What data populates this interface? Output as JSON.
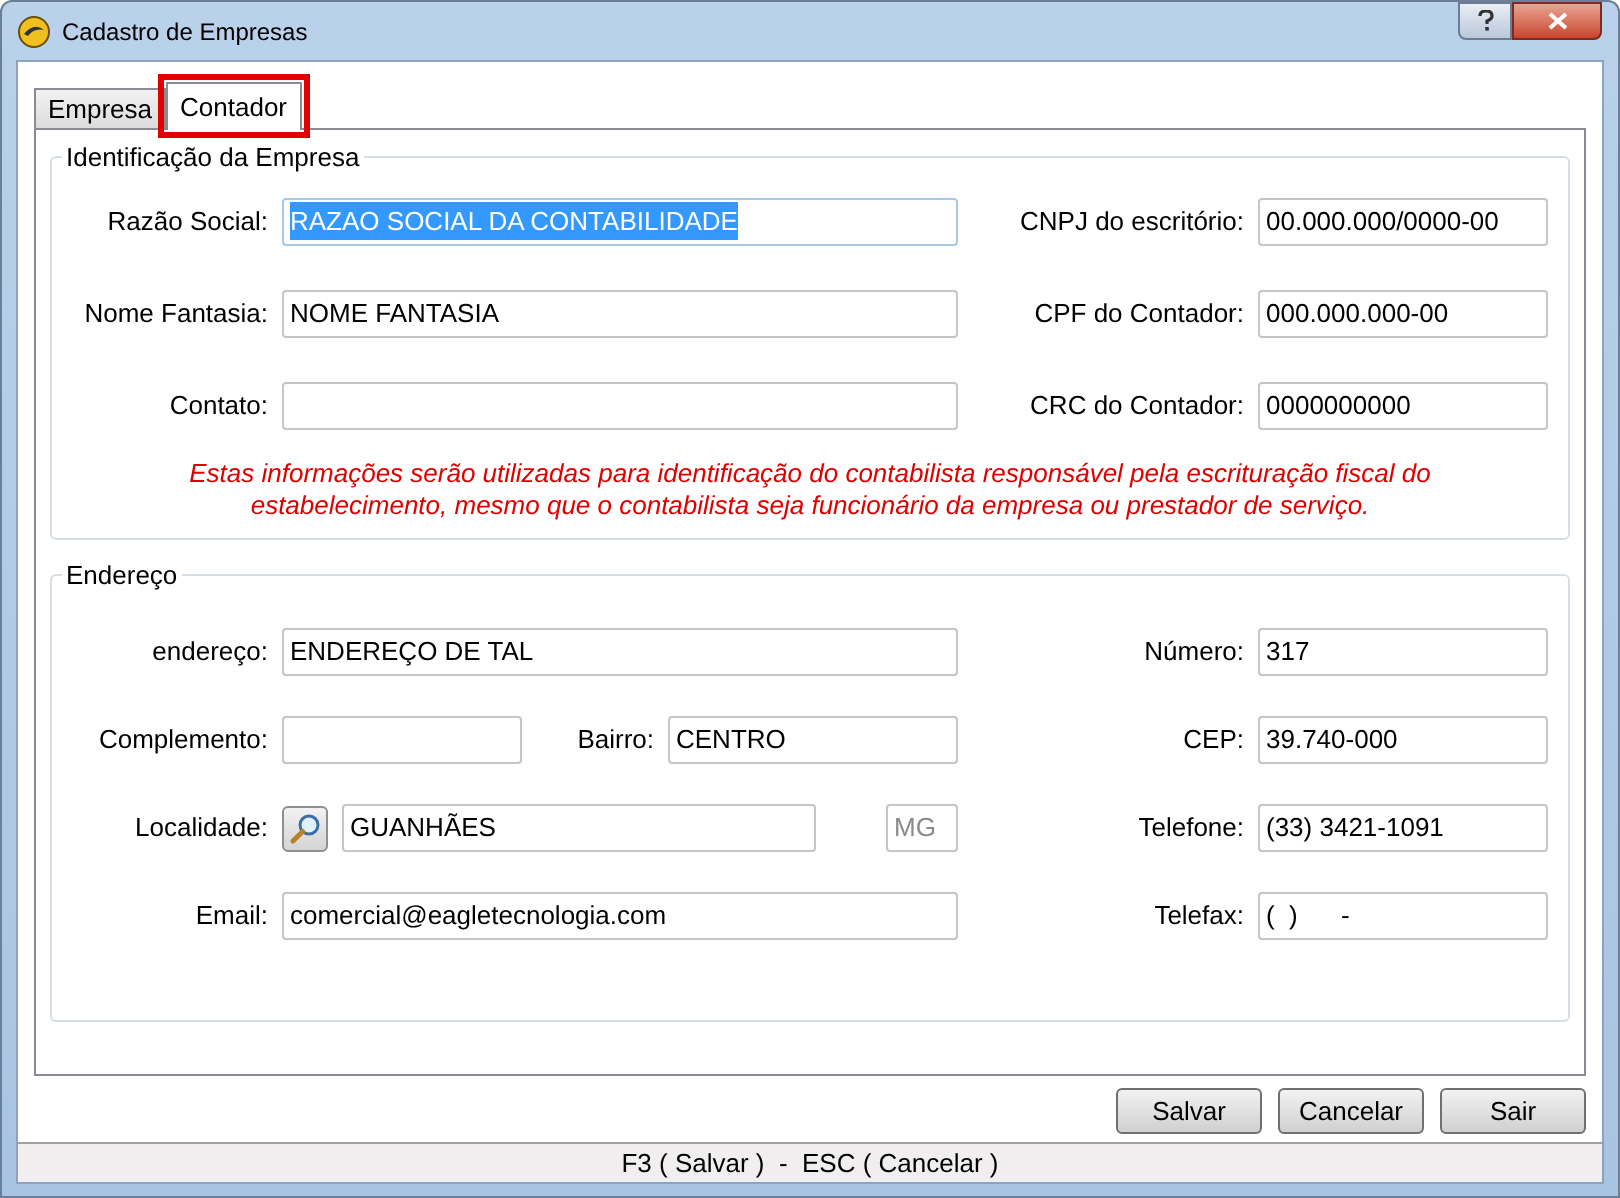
{
  "window": {
    "title": "Cadastro de Empresas"
  },
  "tabs": [
    {
      "label": "Empresa",
      "selected": false,
      "highlighted": false
    },
    {
      "label": "Contador",
      "selected": true,
      "highlighted": true
    }
  ],
  "sections": [
    {
      "title": "Identificação da Empresa",
      "rows": [
        {
          "left": [
            {
              "kind": "field",
              "label": "Razão Social:",
              "value": "RAZAO SOCIAL DA CONTABILIDADE",
              "text_selected": true
            }
          ],
          "right": {
            "label": "CNPJ do escritório:",
            "value": "00.000.000/0000-00"
          }
        },
        {
          "left": [
            {
              "kind": "field",
              "label": "Nome Fantasia:",
              "value": "NOME FANTASIA",
              "text_selected": false
            }
          ],
          "right": {
            "label": "CPF do Contador:",
            "value": "000.000.000-00"
          }
        },
        {
          "left": [
            {
              "kind": "field",
              "label": "Contato:",
              "text_selected": false
            }
          ],
          "right": {
            "label": "CRC do Contador:",
            "value": "0000000000"
          }
        }
      ],
      "note": "Estas informações serão utilizadas para identificação do contabilista responsável pela escrituração fiscal do estabelecimento, mesmo que o contabilista seja funcionário da empresa ou prestador de serviço."
    },
    {
      "title": "Endereço",
      "rows": [
        {
          "left": [
            {
              "kind": "field",
              "label": "endereço:",
              "value": "ENDEREÇO DE TAL",
              "text_selected": false
            }
          ],
          "right": {
            "label": "Número:",
            "value": "317"
          }
        },
        {
          "left": [
            {
              "kind": "short",
              "label": "Complemento:",
              "text_selected": false
            },
            {
              "kind": "medium",
              "label": "Bairro:",
              "value": "CENTRO",
              "text_selected": false
            }
          ],
          "right": {
            "label": "CEP:",
            "value": "39.740-000"
          }
        },
        {
          "left": [
            {
              "kind": "lookup",
              "label": "Localidade:",
              "value": "GUANHÃES",
              "text_selected": false
            },
            {
              "kind": "uf",
              "value": "MG",
              "text_selected": false
            }
          ],
          "right": {
            "label": "Telefone:",
            "value": "(33) 3421-1091"
          }
        },
        {
          "left": [
            {
              "kind": "field",
              "label": "Email:",
              "value": "comercial@eagletecnologia.com",
              "text_selected": false
            }
          ],
          "right": {
            "label": "Telefax:",
            "value": "(  )      -"
          }
        }
      ]
    }
  ],
  "buttons": [
    "Salvar",
    "Cancelar",
    "Sair"
  ],
  "status_bar": "F3 ( Salvar )  -  ESC ( Cancelar )"
}
